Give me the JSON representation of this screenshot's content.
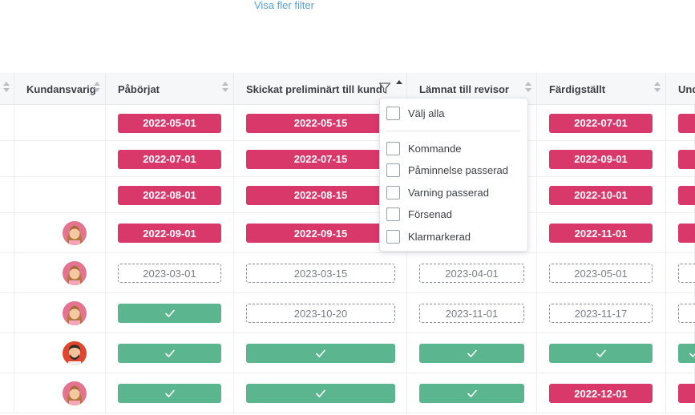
{
  "show_more_filters": "Visa fler filter",
  "columns": {
    "responsible": "Kundansvarig",
    "started": "Påbörjat",
    "sent_preliminary": "Skickat preliminärt till kund",
    "submitted_auditor": "Lämnat till revisor",
    "completed": "Färdigställt",
    "partial": "Und"
  },
  "filter_popup": {
    "select_all": "Välj alla",
    "options": [
      "Kommande",
      "Påminnelse passerad",
      "Varning passerad",
      "Försenad",
      "Klarmarkerad"
    ]
  },
  "rows": [
    {
      "avatar": "",
      "started": {
        "state": "late",
        "text": "2022-05-01"
      },
      "sent": {
        "state": "late",
        "text": "2022-05-15"
      },
      "auditor": {
        "state": "hidden",
        "text": ""
      },
      "completed": {
        "state": "late",
        "text": "2022-07-01"
      },
      "partial": {
        "state": "late",
        "text": ""
      }
    },
    {
      "avatar": "",
      "started": {
        "state": "late",
        "text": "2022-07-01"
      },
      "sent": {
        "state": "late",
        "text": "2022-07-15"
      },
      "auditor": {
        "state": "hidden",
        "text": ""
      },
      "completed": {
        "state": "late",
        "text": "2022-09-01"
      },
      "partial": {
        "state": "late",
        "text": ""
      }
    },
    {
      "avatar": "",
      "started": {
        "state": "late",
        "text": "2022-08-01"
      },
      "sent": {
        "state": "late",
        "text": "2022-08-15"
      },
      "auditor": {
        "state": "hidden",
        "text": ""
      },
      "completed": {
        "state": "late",
        "text": "2022-10-01"
      },
      "partial": {
        "state": "late",
        "text": ""
      }
    },
    {
      "avatar": "woman",
      "started": {
        "state": "late",
        "text": "2022-09-01"
      },
      "sent": {
        "state": "late",
        "text": "2022-09-15"
      },
      "auditor": {
        "state": "hidden",
        "text": ""
      },
      "completed": {
        "state": "late",
        "text": "2022-11-01"
      },
      "partial": {
        "state": "late",
        "text": ""
      }
    },
    {
      "avatar": "woman",
      "started": {
        "state": "upcoming",
        "text": "2023-03-01"
      },
      "sent": {
        "state": "upcoming",
        "text": "2023-03-15"
      },
      "auditor": {
        "state": "upcoming",
        "text": "2023-04-01"
      },
      "completed": {
        "state": "upcoming",
        "text": "2023-05-01"
      },
      "partial": {
        "state": "upcoming",
        "text": ""
      }
    },
    {
      "avatar": "woman",
      "started": {
        "state": "done",
        "text": ""
      },
      "sent": {
        "state": "upcoming",
        "text": "2023-10-20"
      },
      "auditor": {
        "state": "upcoming",
        "text": "2023-11-01"
      },
      "completed": {
        "state": "upcoming",
        "text": "2023-11-17"
      },
      "partial": {
        "state": "upcoming",
        "text": ""
      }
    },
    {
      "avatar": "man",
      "started": {
        "state": "done",
        "text": ""
      },
      "sent": {
        "state": "done",
        "text": ""
      },
      "auditor": {
        "state": "done",
        "text": ""
      },
      "completed": {
        "state": "done",
        "text": ""
      },
      "partial": {
        "state": "done",
        "text": ""
      }
    },
    {
      "avatar": "woman",
      "started": {
        "state": "done",
        "text": ""
      },
      "sent": {
        "state": "done",
        "text": ""
      },
      "auditor": {
        "state": "done",
        "text": ""
      },
      "completed": {
        "state": "late",
        "text": "2022-12-01"
      },
      "partial": {
        "state": "late",
        "text": ""
      }
    }
  ],
  "colors": {
    "late": "#d9386a",
    "done": "#5bb58e",
    "upcoming_border": "#8a8f96",
    "link": "#5a9fd4"
  }
}
